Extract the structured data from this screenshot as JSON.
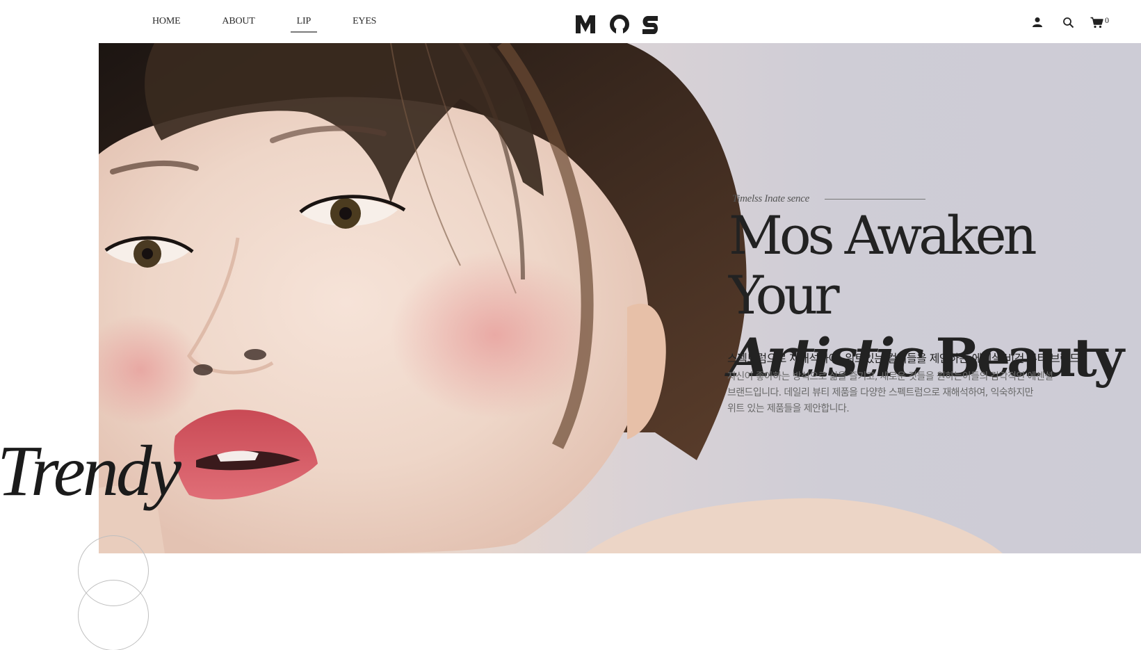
{
  "nav": {
    "items": [
      {
        "label": "HOME",
        "active": false
      },
      {
        "label": "ABOUT",
        "active": false
      },
      {
        "label": "LIP",
        "active": true
      },
      {
        "label": "EYES",
        "active": false
      }
    ]
  },
  "brand": {
    "logo_text": "MOS"
  },
  "utilities": {
    "account_icon": "user-icon",
    "search_icon": "search-icon",
    "cart_icon": "cart-icon",
    "cart_count": "0"
  },
  "hero": {
    "eyebrow": "Timelss Inate sence",
    "headline_line1": "Mos Awaken Your",
    "headline_line2_italic": "Artistic",
    "headline_line2_rest": "Beauty",
    "subheadline": "스펙트럼으로 재해석하여, 위트있는 컬러들을 제안하는 에센셜 비건 뷰티 브랜드",
    "body_line1": "자신이 좋아하는 방식으로 삶을 즐기고, 새로운 것들을 원하는이들의 감각적인 에센셜",
    "body_line2": "브랜드입니다. 데일리 뷰티 제품을 다양한 스펙트럼으로 재해석하여, 익숙하지만",
    "body_line3": "위트 있는 제품들을 제안합니다."
  },
  "decor": {
    "side_word": "Trendy"
  },
  "colors": {
    "text": "#222222",
    "background": "#ffffff",
    "hero_bg": "#cdccd6",
    "lip": "#d9545f"
  }
}
